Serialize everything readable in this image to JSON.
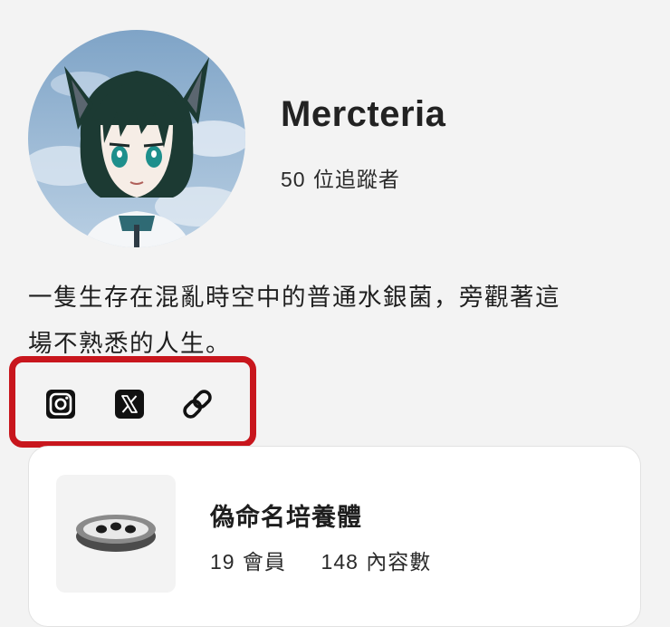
{
  "profile": {
    "name": "Mercteria",
    "followers_count": "50",
    "followers_label": "位追蹤者",
    "bio_line1": "一隻生存在混亂時空中的普通水銀菌，旁觀著這",
    "bio_line2": "場不熟悉的人生。"
  },
  "links": [
    {
      "icon": "instagram-icon"
    },
    {
      "icon": "x-icon"
    },
    {
      "icon": "link-icon"
    }
  ],
  "highlight_color": "#c8161d",
  "community": {
    "name": "偽命名培養體",
    "members_count": "19",
    "members_label": "會員",
    "posts_count": "148",
    "posts_label": "內容數"
  }
}
